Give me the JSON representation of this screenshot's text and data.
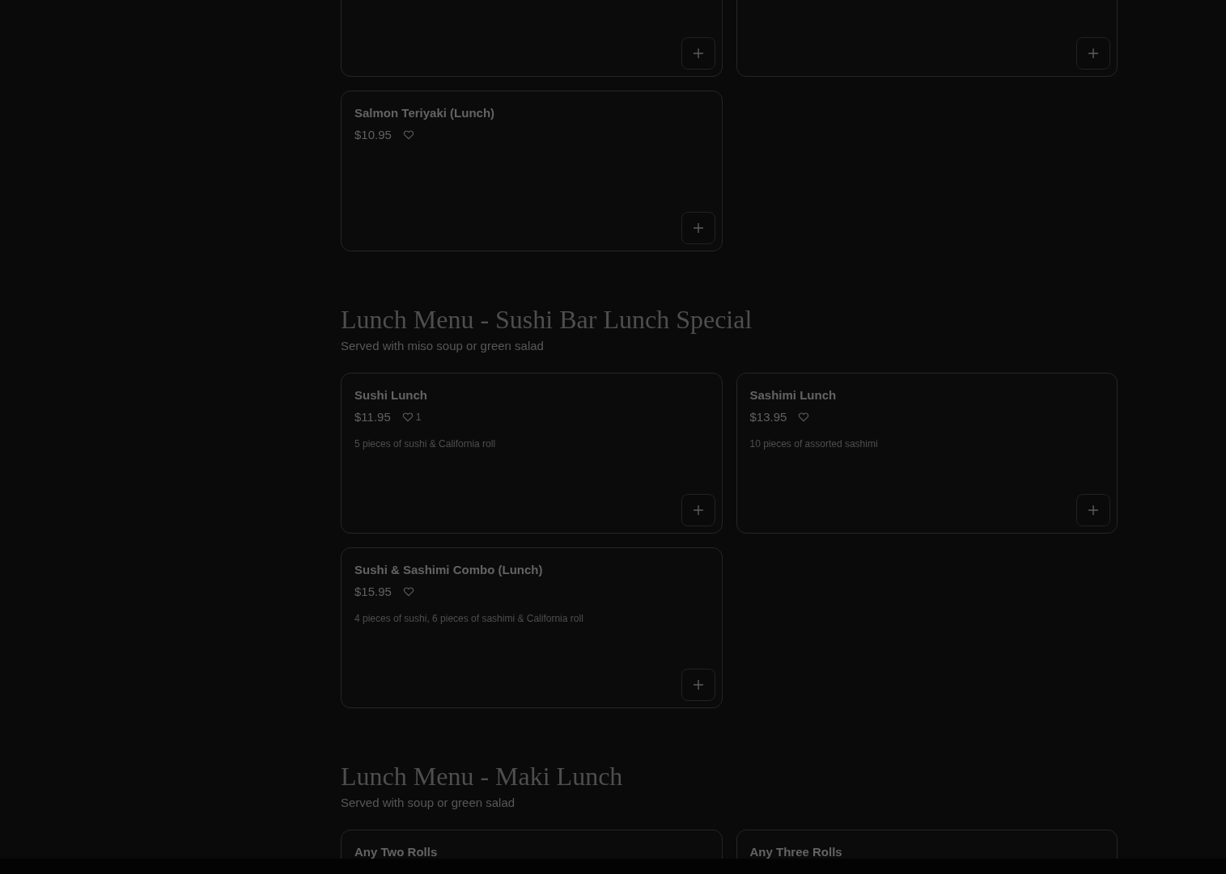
{
  "sections": [
    {
      "items": [
        {
          "kind": "cut",
          "add_button": true
        },
        {
          "kind": "cut",
          "add_button": true
        },
        {
          "kind": "full",
          "name": "Salmon Teriyaki (Lunch)",
          "price": "$10.95",
          "add_button": true
        }
      ]
    },
    {
      "title": "Lunch Menu - Sushi Bar Lunch Special",
      "subtitle": "Served with miso soup or green salad",
      "items": [
        {
          "kind": "full",
          "name": "Sushi Lunch",
          "price": "$11.95",
          "likes": "1",
          "description": "5 pieces of sushi & California roll",
          "add_button": true
        },
        {
          "kind": "full",
          "name": "Sashimi Lunch",
          "price": "$13.95",
          "description": "10 pieces of assorted sashimi",
          "add_button": true
        },
        {
          "kind": "full",
          "name": "Sushi & Sashimi Combo (Lunch)",
          "price": "$15.95",
          "description": "4 pieces of sushi, 6 pieces of sashimi & California roll",
          "add_button": true
        }
      ]
    },
    {
      "title": "Lunch Menu - Maki Lunch",
      "subtitle": "Served with soup or green salad",
      "items": [
        {
          "kind": "full",
          "name": "Any Two Rolls"
        },
        {
          "kind": "full",
          "name": "Any Three Rolls"
        }
      ]
    }
  ]
}
